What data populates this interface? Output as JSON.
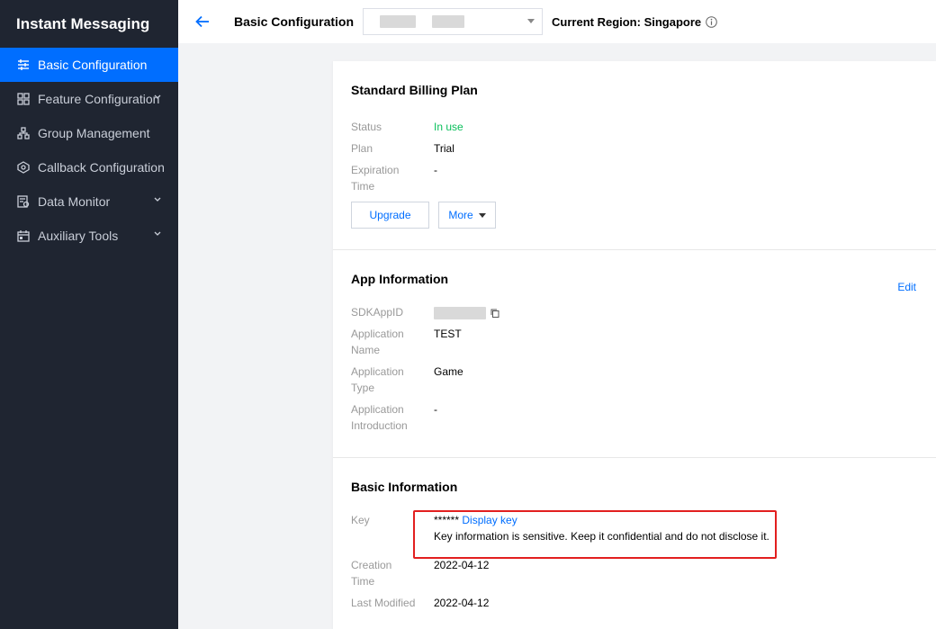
{
  "sidebar": {
    "title": "Instant Messaging",
    "items": [
      {
        "label": "Basic Configuration",
        "icon": "sliders-icon",
        "active": true
      },
      {
        "label": "Feature Configuration",
        "icon": "grid-icon",
        "expandable": true
      },
      {
        "label": "Group Management",
        "icon": "hierarchy-icon"
      },
      {
        "label": "Callback Configuration",
        "icon": "callback-icon"
      },
      {
        "label": "Data Monitor",
        "icon": "monitor-icon",
        "expandable": true
      },
      {
        "label": "Auxiliary Tools",
        "icon": "calendar-icon",
        "expandable": true
      }
    ]
  },
  "topbar": {
    "page_title": "Basic Configuration",
    "region_label": "Current Region: Singapore"
  },
  "billing": {
    "title": "Standard Billing Plan",
    "status_label": "Status",
    "status_value": "In use",
    "plan_label": "Plan",
    "plan_value": "Trial",
    "expiration_label": "Expiration Time",
    "expiration_value": "-",
    "upgrade_label": "Upgrade",
    "more_label": "More"
  },
  "app_info": {
    "title": "App Information",
    "edit_label": "Edit",
    "sdkappid_label": "SDKAppID",
    "name_label": "Application Name",
    "name_value": "TEST",
    "type_label": "Application Type",
    "type_value": "Game",
    "intro_label": "Application Introduction",
    "intro_value": "-"
  },
  "basic_info": {
    "title": "Basic Information",
    "key_label": "Key",
    "key_mask": "******",
    "display_key_label": "Display key",
    "key_warning": "Key information is sensitive. Keep it confidential and do not disclose it.",
    "creation_label": "Creation Time",
    "creation_value": "2022-04-12",
    "modified_label": "Last Modified",
    "modified_value": "2022-04-12"
  },
  "colors": {
    "accent": "#006eff",
    "sidebar_bg": "#1f2531",
    "status_ok": "#0abf5b",
    "highlight": "#e21f1f"
  }
}
